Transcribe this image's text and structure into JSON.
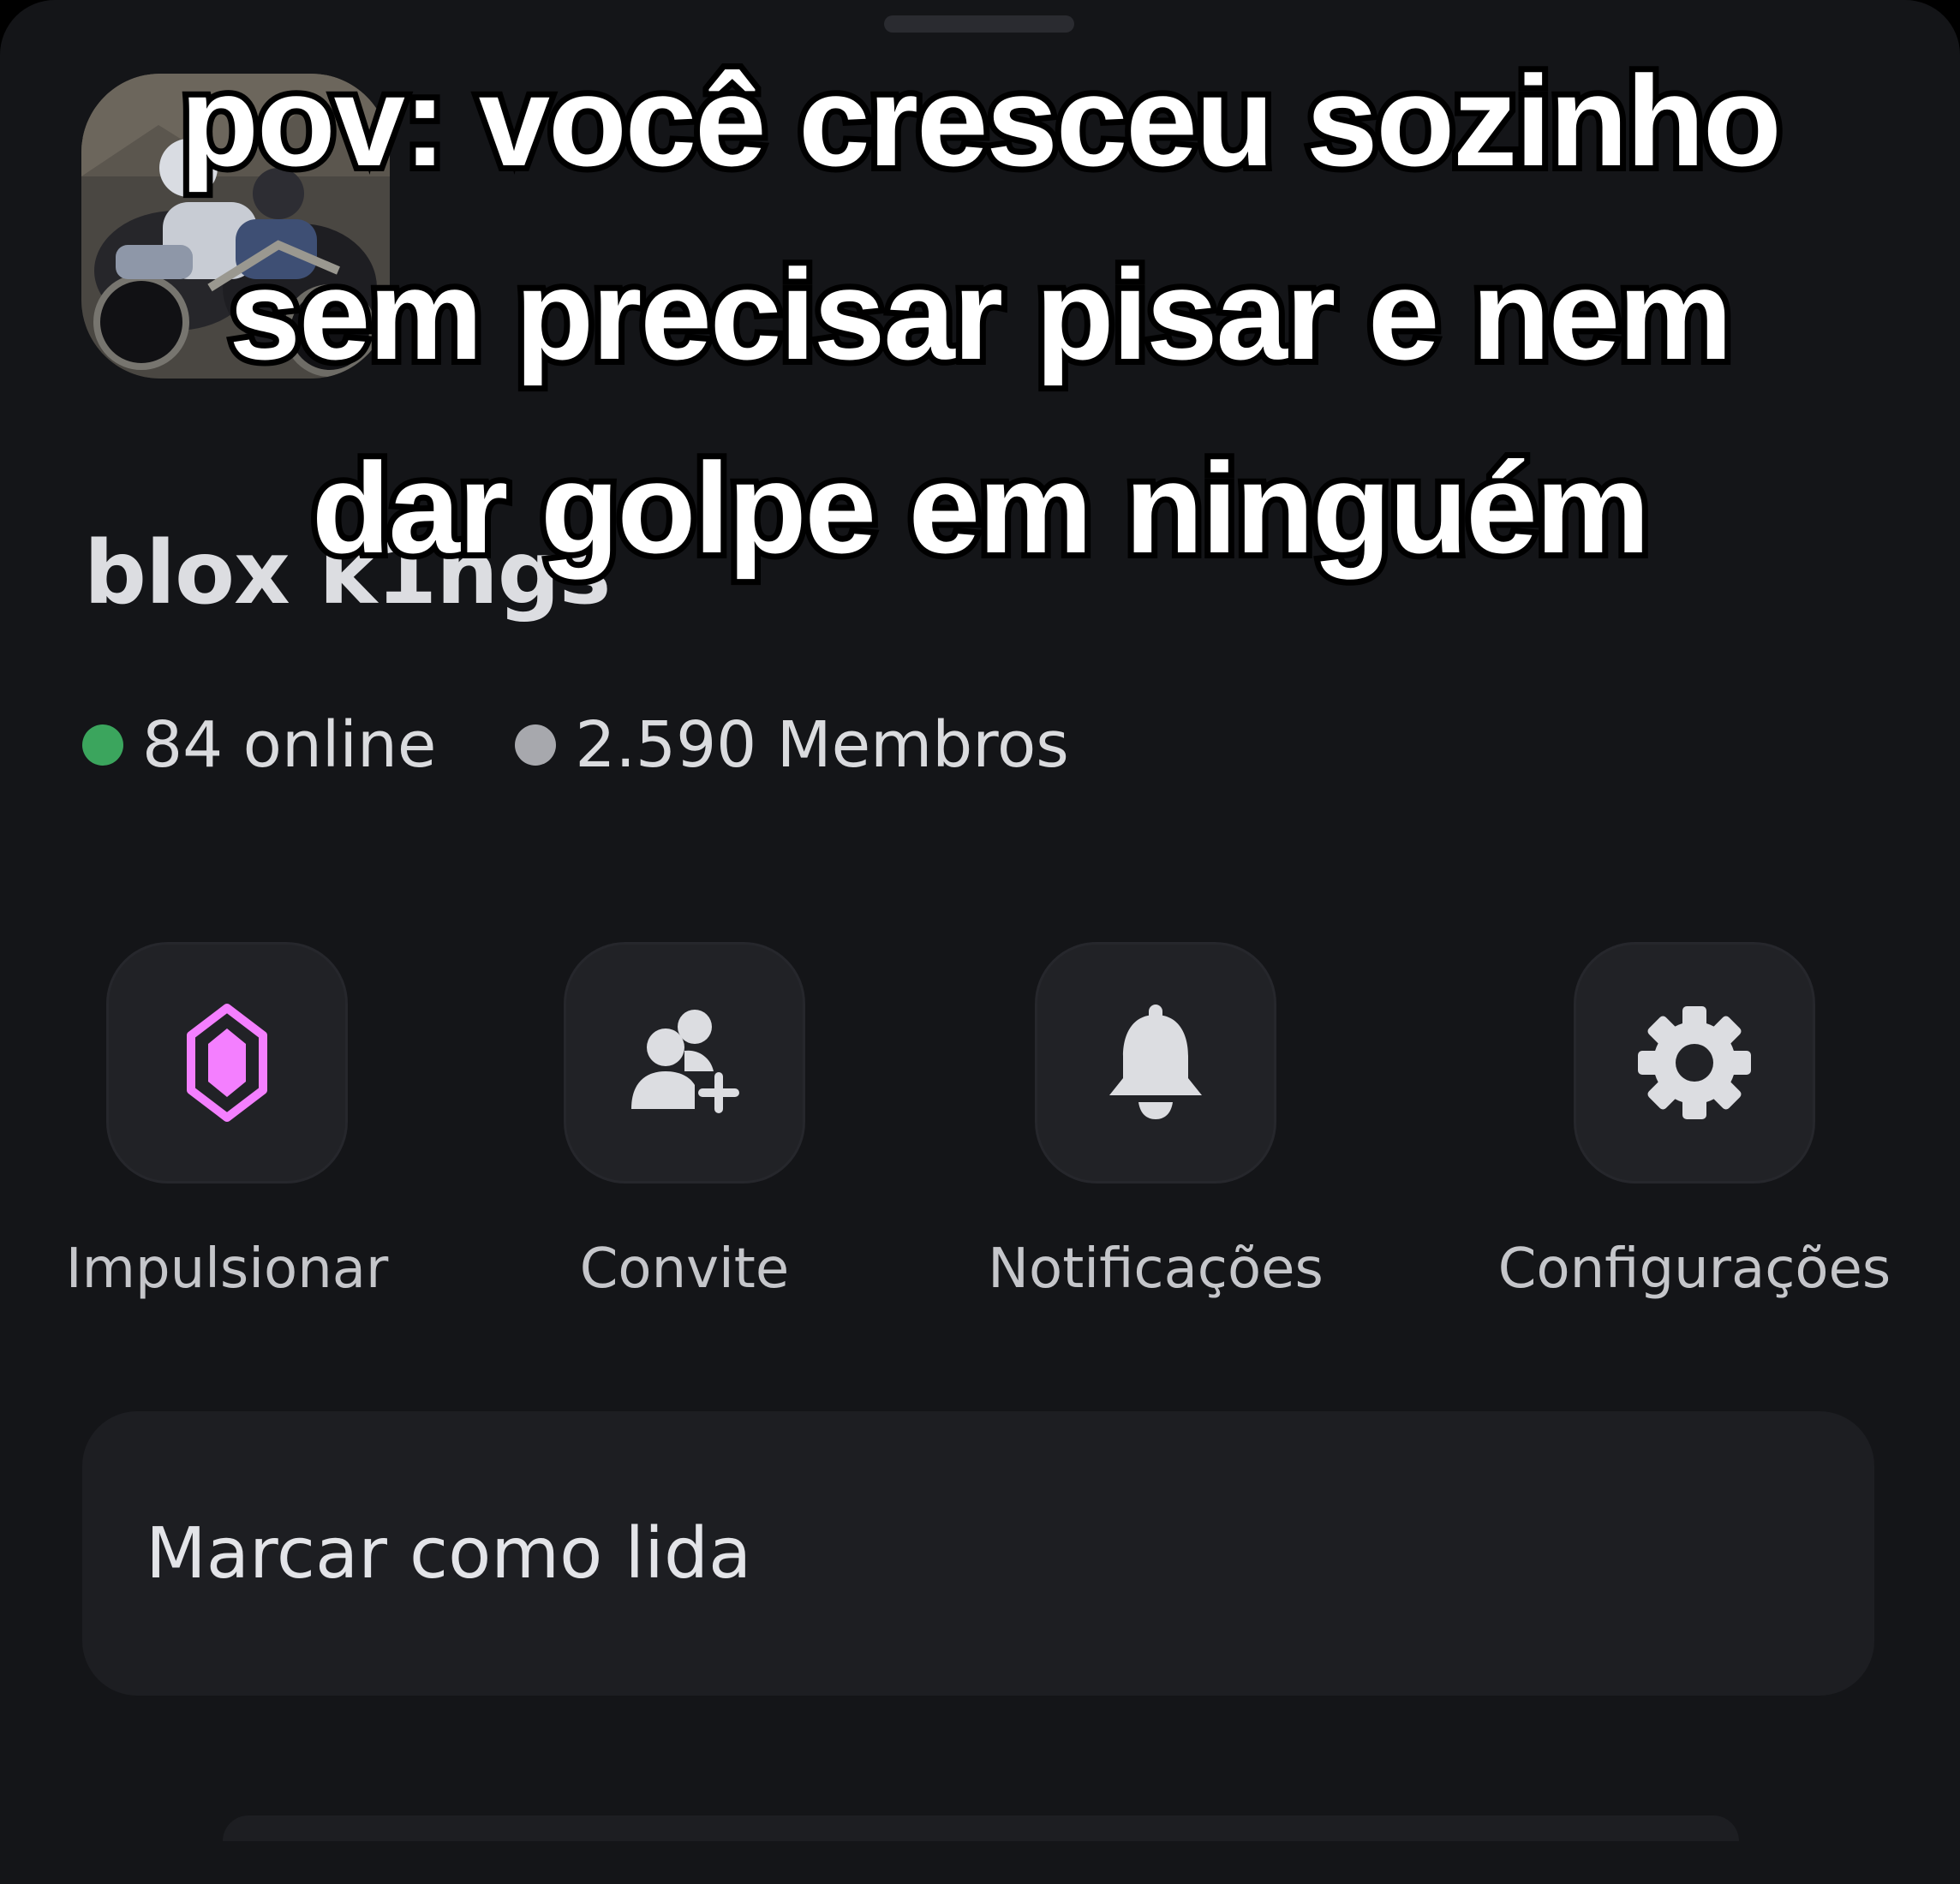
{
  "server": {
    "name": "blox k1ngs",
    "icon": "server-photo-motorcycle-riders"
  },
  "stats": {
    "online": "84 online",
    "members": "2.590 Membros",
    "online_color": "#3ba55d",
    "members_color": "#a7a8ad"
  },
  "actions": [
    {
      "label": "Impulsionar",
      "icon": "nitro-boost-icon",
      "color": "#f47fff"
    },
    {
      "label": "Convite",
      "icon": "add-person-icon",
      "color": "#dcdde1"
    },
    {
      "label": "Notificações",
      "icon": "bell-icon",
      "color": "#dcdde1"
    },
    {
      "label": "Configurações",
      "icon": "gear-icon",
      "color": "#dcdde1"
    }
  ],
  "menu": {
    "mark_read": "Marcar como lida"
  },
  "caption": {
    "line1": "pov: você cresceu sozinho",
    "line2": "sem precisar pisar e nem",
    "line3": "dar golpe em ninguém"
  }
}
